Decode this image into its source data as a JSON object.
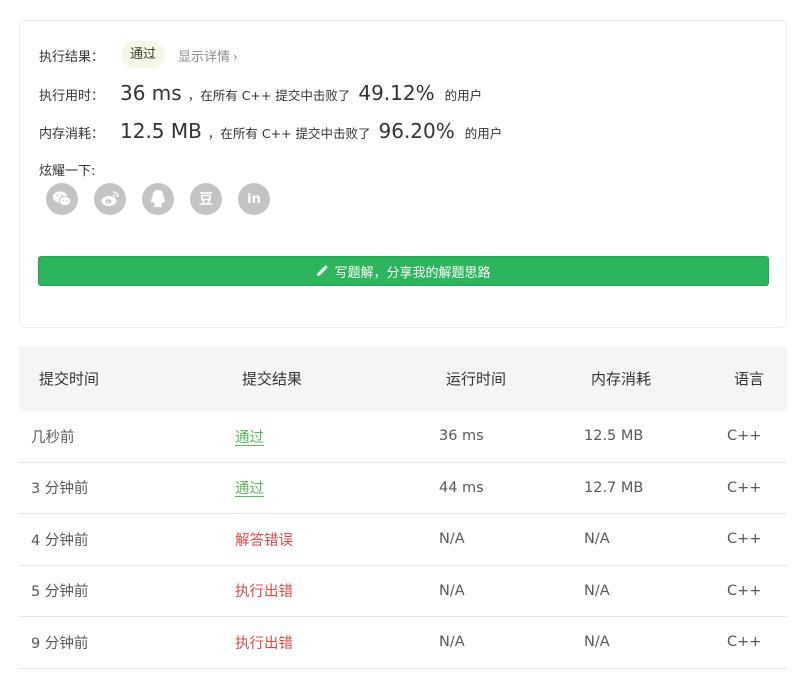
{
  "result": {
    "label": "执行结果：",
    "status": "通过",
    "detail_link": "显示详情",
    "chevron": "›"
  },
  "runtime": {
    "label": "执行用时：",
    "value": "36 ms",
    "mid_text": "，在所有 C++ 提交中击败了",
    "percent": "49.12%",
    "suffix": "的用户"
  },
  "memory": {
    "label": "内存消耗：",
    "value": "12.5 MB",
    "mid_text": "，在所有 C++ 提交中击败了",
    "percent": "96.20%",
    "suffix": "的用户"
  },
  "share": {
    "label": "炫耀一下:",
    "icons": [
      "wechat-icon",
      "weibo-icon",
      "qq-icon",
      "douban-icon",
      "linkedin-icon"
    ],
    "douban_glyph": "豆",
    "linkedin_glyph": "in"
  },
  "solution_button": {
    "label": "写题解，分享我的解题思路",
    "icon": "pencil-icon",
    "color": "#2db55d"
  },
  "table": {
    "headers": [
      "提交时间",
      "提交结果",
      "运行时间",
      "内存消耗",
      "语言"
    ],
    "rows": [
      {
        "time": "几秒前",
        "result": "通过",
        "result_type": "ok",
        "runtime": "36 ms",
        "memory": "12.5 MB",
        "lang": "C++"
      },
      {
        "time": "3 分钟前",
        "result": "通过",
        "result_type": "ok",
        "runtime": "44 ms",
        "memory": "12.7 MB",
        "lang": "C++"
      },
      {
        "time": "4 分钟前",
        "result": "解答错误",
        "result_type": "err",
        "runtime": "N/A",
        "memory": "N/A",
        "lang": "C++"
      },
      {
        "time": "5 分钟前",
        "result": "执行出错",
        "result_type": "err",
        "runtime": "N/A",
        "memory": "N/A",
        "lang": "C++"
      },
      {
        "time": "9 分钟前",
        "result": "执行出错",
        "result_type": "err",
        "runtime": "N/A",
        "memory": "N/A",
        "lang": "C++"
      }
    ]
  },
  "colors": {
    "accept": "#5cb85c",
    "error": "#e04a4a",
    "button_green": "#2db55d",
    "icon_gray": "#c4c4c4"
  }
}
